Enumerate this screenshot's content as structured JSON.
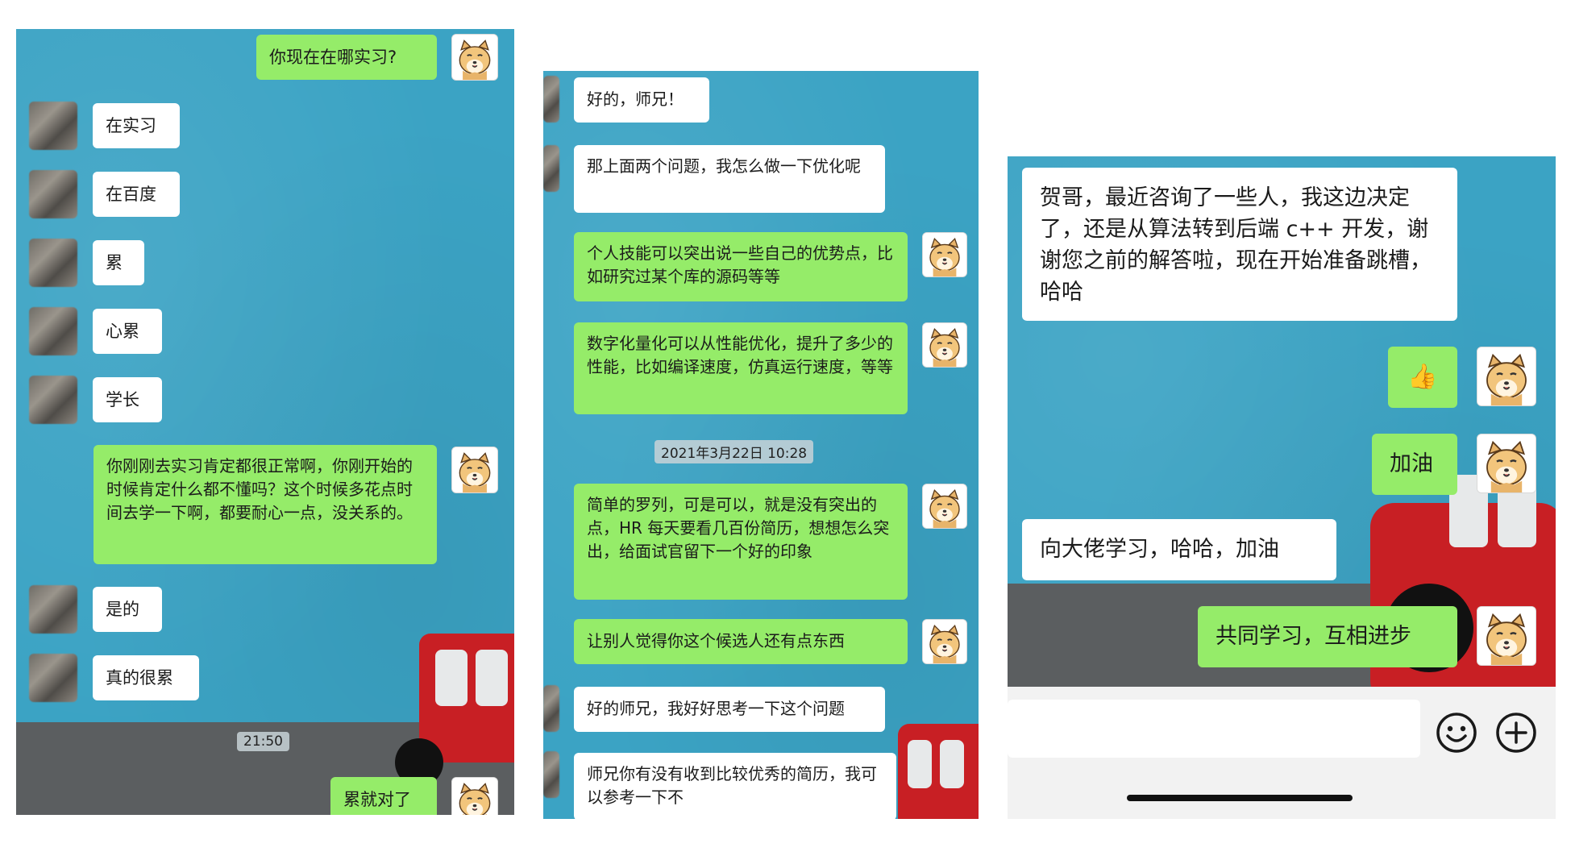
{
  "left": {
    "messages": [
      {
        "from": "me",
        "text": "你现在在哪实习?"
      },
      {
        "from": "other",
        "text": "在实习"
      },
      {
        "from": "other",
        "text": "在百度"
      },
      {
        "from": "other",
        "text": "累"
      },
      {
        "from": "other",
        "text": "心累"
      },
      {
        "from": "other",
        "text": "学长"
      },
      {
        "from": "me",
        "text": "你刚刚去实习肯定都很正常啊，你刚开始的时候肯定什么都不懂吗？这个时候多花点时间去学一下啊，都要耐心一点，没关系的。"
      },
      {
        "from": "other",
        "text": "是的"
      },
      {
        "from": "other",
        "text": "真的很累"
      },
      {
        "from": "me",
        "text": "累就对了"
      }
    ],
    "timestamp": "21:50"
  },
  "middle": {
    "messages": [
      {
        "from": "other",
        "text": "好的，师兄！"
      },
      {
        "from": "other",
        "text": "那上面两个问题，我怎么做一下优化呢"
      },
      {
        "from": "me",
        "text": "个人技能可以突出说一些自己的优势点，比如研究过某个库的源码等等"
      },
      {
        "from": "me",
        "text": "数字化量化可以从性能优化，提升了多少的性能，比如编译速度，仿真运行速度，等等"
      },
      {
        "from": "me",
        "text": "简单的罗列，可是可以，就是没有突出的点，HR 每天要看几百份简历，想想怎么突出，给面试官留下一个好的印象"
      },
      {
        "from": "me",
        "text": "让别人觉得你这个候选人还有点东西"
      },
      {
        "from": "other",
        "text": "好的师兄，我好好思考一下这个问题"
      },
      {
        "from": "other",
        "text": "师兄你有没有收到比较优秀的简历，我可以参考一下不"
      }
    ],
    "timestamp": "2021年3月22日 10:28"
  },
  "right": {
    "messages": [
      {
        "from": "other",
        "text": "贺哥，最近咨询了一些人，我这边决定了，还是从算法转到后端 c++ 开发，谢谢您之前的解答啦，现在开始准备跳槽，哈哈"
      },
      {
        "from": "me",
        "text": "👍"
      },
      {
        "from": "me",
        "text": "加油"
      },
      {
        "from": "other",
        "text": "向大佬学习，哈哈，加油"
      },
      {
        "from": "me",
        "text": "共同学习，互相进步"
      }
    ],
    "icons": {
      "emoji": "emoji-icon",
      "add": "add-icon"
    }
  },
  "colors": {
    "me_bubble": "#95ec69",
    "other_bubble": "#ffffff",
    "wallpaper": "#3ba3c4",
    "car": "#c81f24"
  }
}
